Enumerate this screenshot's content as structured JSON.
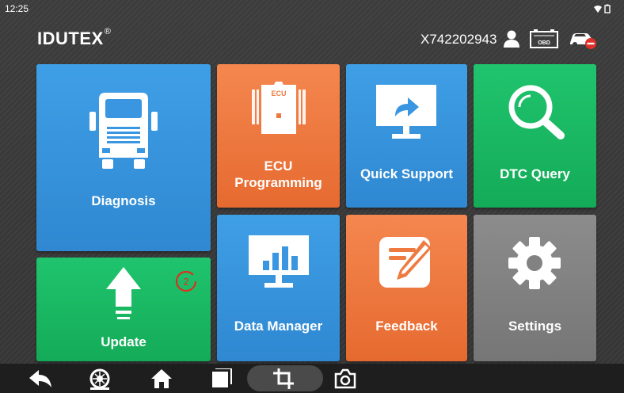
{
  "status": {
    "time": "12:25"
  },
  "header": {
    "brand": "IDUTEX",
    "brand_mark": "®",
    "serial": "X742202943"
  },
  "tiles": {
    "diagnosis": "Diagnosis",
    "ecu_line1": "ECU",
    "ecu_line2": "Programming",
    "ecu_chip": "ECU",
    "quick_support": "Quick Support",
    "dtc_query": "DTC Query",
    "update": "Update",
    "update_badge": "2",
    "data_manager": "Data Manager",
    "feedback": "Feedback",
    "settings": "Settings"
  },
  "header_icons": {
    "obd": "OBD"
  },
  "icons": [
    "wifi-icon",
    "battery-icon",
    "user-icon",
    "obd-icon",
    "vehicle-disconnected-icon",
    "truck-icon",
    "ecu-chip-icon",
    "monitor-arrow-icon",
    "magnifier-icon",
    "upload-arrow-icon",
    "bar-chart-monitor-icon",
    "edit-note-icon",
    "gear-icon",
    "back-icon",
    "tire-icon",
    "home-icon",
    "recent-apps-icon",
    "crop-icon",
    "camera-icon"
  ],
  "colors": {
    "blue": "#3a96e0",
    "orange": "#ee7a40",
    "green": "#1ab962",
    "gray": "#828282",
    "navbar": "#1e1e1e"
  }
}
